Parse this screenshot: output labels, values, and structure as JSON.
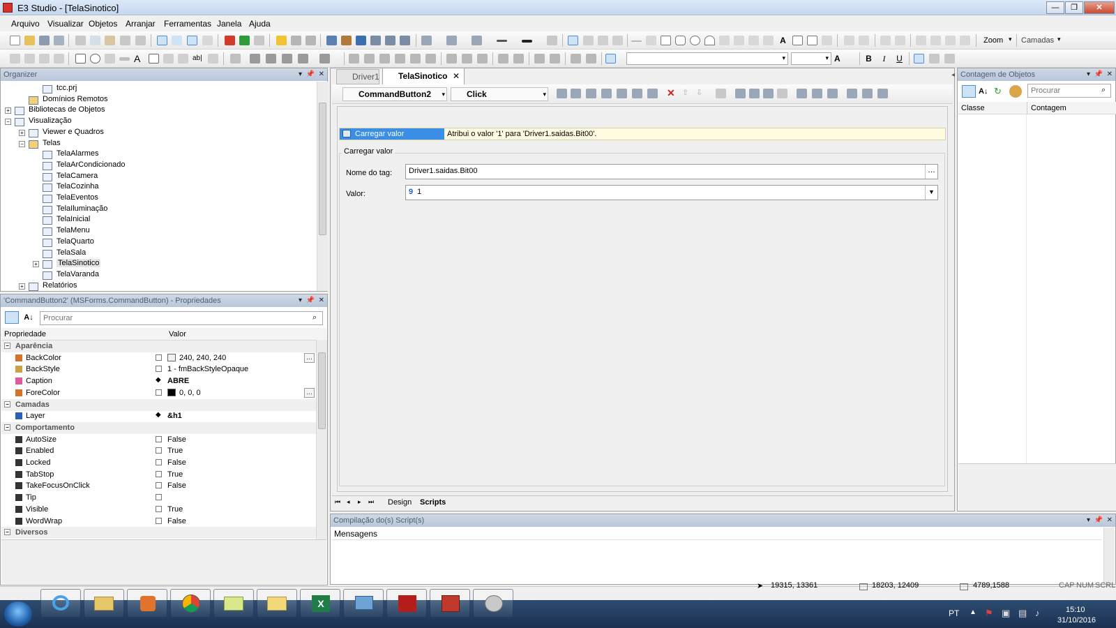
{
  "window": {
    "title": "E3 Studio - [TelaSinotico]"
  },
  "menu": [
    "Arquivo",
    "Visualizar",
    "Objetos",
    "Arranjar",
    "Ferramentas",
    "Janela",
    "Ajuda"
  ],
  "toolbar": {
    "zoom_label": "Zoom",
    "layers_label": "Camadas"
  },
  "organizer": {
    "title": "Organizer",
    "items": [
      {
        "label": "tcc.prj"
      },
      {
        "label": "Domínios Remotos"
      },
      {
        "label": "Bibliotecas de Objetos"
      },
      {
        "label": "Visualização"
      },
      {
        "label": "Viewer e Quadros"
      },
      {
        "label": "Telas"
      },
      {
        "label": "TelaAlarmes"
      },
      {
        "label": "TelaArCondicionado"
      },
      {
        "label": "TelaCamera"
      },
      {
        "label": "TelaCozinha"
      },
      {
        "label": "TelaEventos"
      },
      {
        "label": "TelaIluminação"
      },
      {
        "label": "TelaInicial"
      },
      {
        "label": "TelaMenu"
      },
      {
        "label": "TelaQuarto"
      },
      {
        "label": "TelaSala"
      },
      {
        "label": "TelaSinotico"
      },
      {
        "label": "TelaVaranda"
      },
      {
        "label": "Relatórios"
      }
    ]
  },
  "properties": {
    "title": "'CommandButton2' (MSForms.CommandButton) - Propriedades",
    "search_placeholder": "Procurar",
    "col_property": "Propriedade",
    "col_value": "Valor",
    "rows": [
      {
        "cat": "Aparência"
      },
      {
        "name": "BackColor",
        "value": "240, 240, 240"
      },
      {
        "name": "BackStyle",
        "value": "1 - fmBackStyleOpaque"
      },
      {
        "name": "Caption",
        "value": "ABRE"
      },
      {
        "name": "ForeColor",
        "value": "0, 0, 0"
      },
      {
        "cat": "Camadas"
      },
      {
        "name": "Layer",
        "value": "&h1"
      },
      {
        "cat": "Comportamento"
      },
      {
        "name": "AutoSize",
        "value": "False"
      },
      {
        "name": "Enabled",
        "value": "True"
      },
      {
        "name": "Locked",
        "value": "False"
      },
      {
        "name": "TabStop",
        "value": "True"
      },
      {
        "name": "TakeFocusOnClick",
        "value": "False"
      },
      {
        "name": "Tip",
        "value": ""
      },
      {
        "name": "Visible",
        "value": "True"
      },
      {
        "name": "WordWrap",
        "value": "False"
      },
      {
        "cat": "Diversos"
      }
    ]
  },
  "editor": {
    "tabs": [
      {
        "label": "Driver1"
      },
      {
        "label": "TelaSinotico"
      }
    ],
    "object_select": "CommandButton2",
    "event_select": "Click",
    "action_name": "Carregar valor",
    "action_desc": "Atribui o valor '1' para 'Driver1.saidas.Bit00'.",
    "group_title": "Carregar valor",
    "tag_label": "Nome do tag:",
    "tag_value": "Driver1.saidas.Bit00",
    "value_label": "Valor:",
    "value_value": "1",
    "bottom_tabs": [
      "Design",
      "Scripts"
    ]
  },
  "object_count": {
    "title": "Contagem de Objetos",
    "search_placeholder": "Procurar",
    "col_class": "Classe",
    "col_count": "Contagem"
  },
  "compile": {
    "title": "Compilação do(s) Script(s)",
    "col_messages": "Mensagens"
  },
  "statusbar": {
    "pos1": "19315, 13361",
    "pos2": "18203, 12409",
    "size": "4789,1588",
    "caps": "CAP",
    "num": "NUM",
    "scrl": "SCRL"
  },
  "taskbar": {
    "lang": "PT",
    "time": "15:10",
    "date": "31/10/2016"
  }
}
